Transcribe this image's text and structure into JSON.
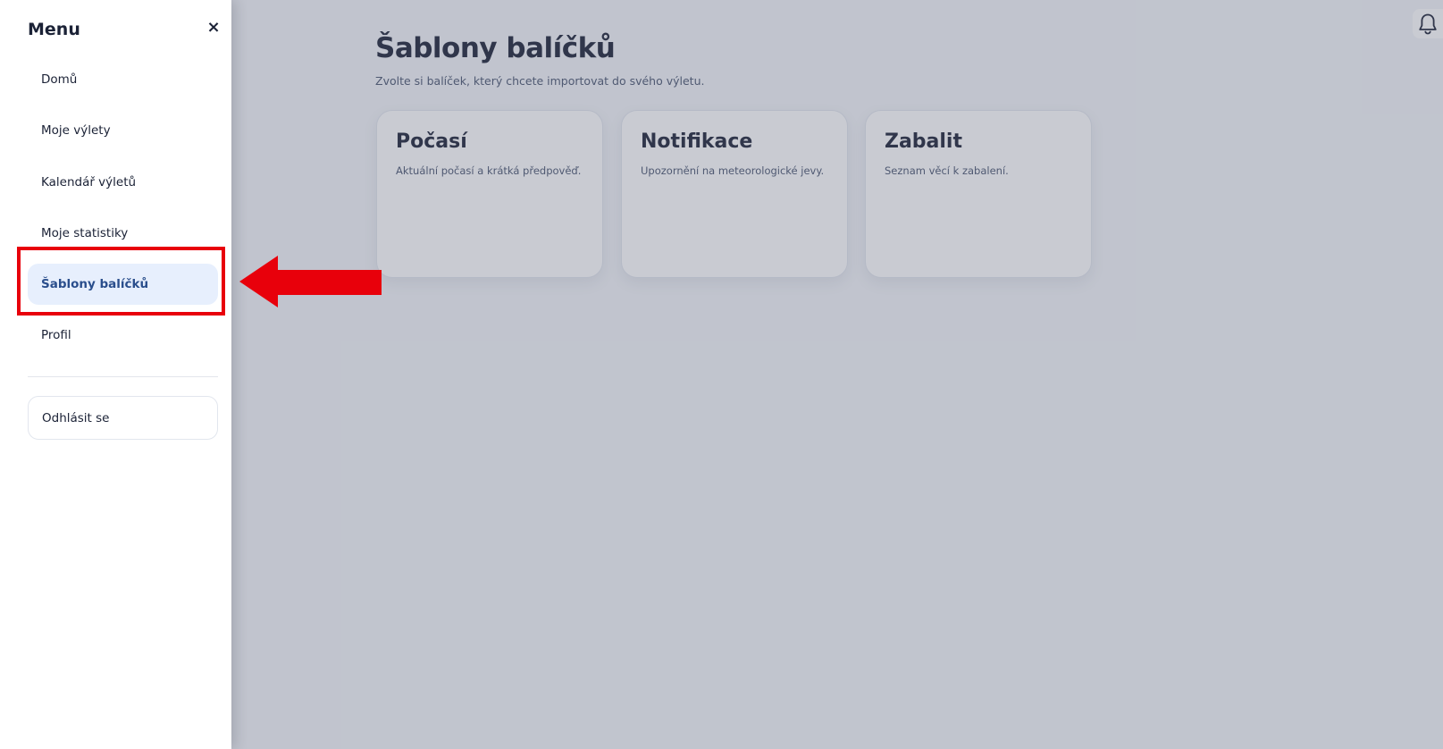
{
  "main": {
    "title": "Šablony balíčků",
    "subtitle": "Zvolte si balíček, který chcete importovat do svého výletu.",
    "cards": [
      {
        "title": "Počasí",
        "description": "Aktuální počasí a krátká předpověď."
      },
      {
        "title": "Notifikace",
        "description": "Upozornění na meteorologické jevy."
      },
      {
        "title": "Zabalit",
        "description": "Seznam věcí k zabalení."
      }
    ],
    "bell_icon": "bell-icon"
  },
  "drawer": {
    "title": "Menu",
    "close_label": "×",
    "items": [
      {
        "label": "Domů",
        "active": false
      },
      {
        "label": "Moje výlety",
        "active": false
      },
      {
        "label": "Kalendář výletů",
        "active": false
      },
      {
        "label": "Moje statistiky",
        "active": false
      },
      {
        "label": "Šablony balíčků",
        "active": true
      },
      {
        "label": "Profil",
        "active": false
      }
    ],
    "logout_label": "Odhlásit se"
  },
  "colors": {
    "active_bg": "#e7effd",
    "active_text": "#2a4e8c",
    "annotation_red": "#e8000b",
    "text_dark": "#1b2236"
  }
}
